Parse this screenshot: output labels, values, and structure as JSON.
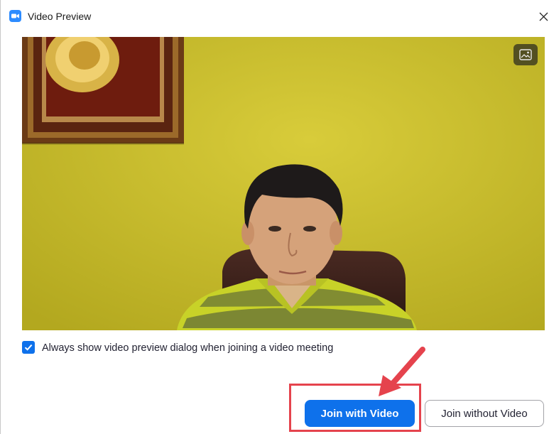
{
  "window": {
    "title": "Video Preview",
    "app_icon": "zoom-logo-icon",
    "close_icon": "close-icon",
    "accent_color": "#0e71eb"
  },
  "video": {
    "background_toggle_icon": "image-icon"
  },
  "options": {
    "always_show_preview": {
      "label": "Always show video preview dialog when joining a video meeting",
      "checked": true
    }
  },
  "actions": {
    "join_with_video": "Join with Video",
    "join_without_video": "Join without Video"
  },
  "annotation": {
    "color": "#e5434d"
  }
}
